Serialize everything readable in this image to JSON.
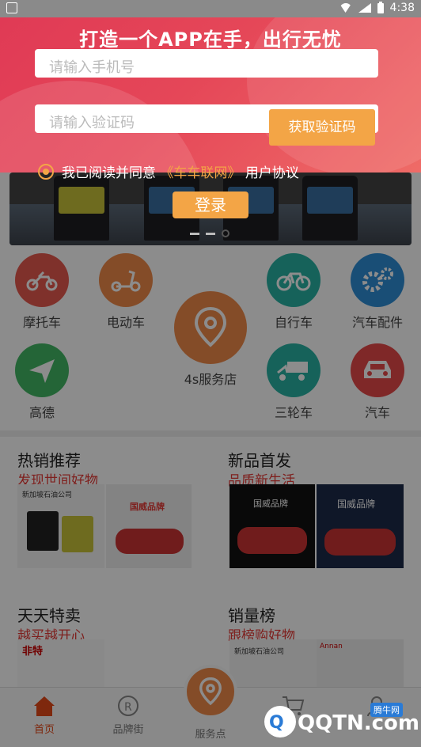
{
  "status_bar": {
    "time": "4:38"
  },
  "login_panel": {
    "title": "打造一个APP在手，出行无忧",
    "phone_placeholder": "请输入手机号",
    "code_placeholder": "请输入验证码",
    "get_code_label": "获取验证码",
    "agree_prefix": "我已阅读并同意",
    "agree_link": "《车车联网》",
    "agree_suffix": "用户协议",
    "login_label": "登录"
  },
  "categories": [
    {
      "label": "摩托车",
      "icon": "motorcycle-icon",
      "color": "#e85a4f"
    },
    {
      "label": "电动车",
      "icon": "scooter-icon",
      "color": "#f08a4a"
    },
    {
      "label": "自行车",
      "icon": "bicycle-icon",
      "color": "#28b3a4"
    },
    {
      "label": "汽车配件",
      "icon": "gears-icon",
      "color": "#2f8fd8"
    },
    {
      "label": "高德",
      "icon": "navigation-arrow-icon",
      "color": "#43b864"
    },
    {
      "label": "三轮车",
      "icon": "tricycle-icon",
      "color": "#28b3a4"
    },
    {
      "label": "汽车",
      "icon": "car-icon",
      "color": "#e84a4a"
    }
  ],
  "service_center": {
    "label": "4s服务店",
    "icon": "location-pin-icon",
    "color": "#f08a4a"
  },
  "sections": [
    {
      "title": "热销推荐",
      "subtitle": "发现世间好物"
    },
    {
      "title": "新品首发",
      "subtitle": "品质新生活"
    },
    {
      "title": "天天特卖",
      "subtitle": "越买越开心"
    },
    {
      "title": "销量榜",
      "subtitle": "跟榜购好物"
    }
  ],
  "product_texts": {
    "company": "新加坡石油公司",
    "brand": "国威品牌",
    "brand2": "国威品牌",
    "feite": "非特",
    "annan": "Annan"
  },
  "tabs": [
    {
      "label": "首页",
      "icon": "home-icon"
    },
    {
      "label": "品牌街",
      "icon": "brand-icon"
    },
    {
      "label": "服务点",
      "icon": "location-pin-icon"
    },
    {
      "label": "",
      "icon": "cart-icon"
    },
    {
      "label": "",
      "icon": "user-icon"
    }
  ],
  "watermark": {
    "text": "QQTN.com",
    "badge": "腾牛网"
  },
  "colors": {
    "accent": "#f3a546",
    "primary_red": "#e54758",
    "active_tab": "#e64a19"
  }
}
